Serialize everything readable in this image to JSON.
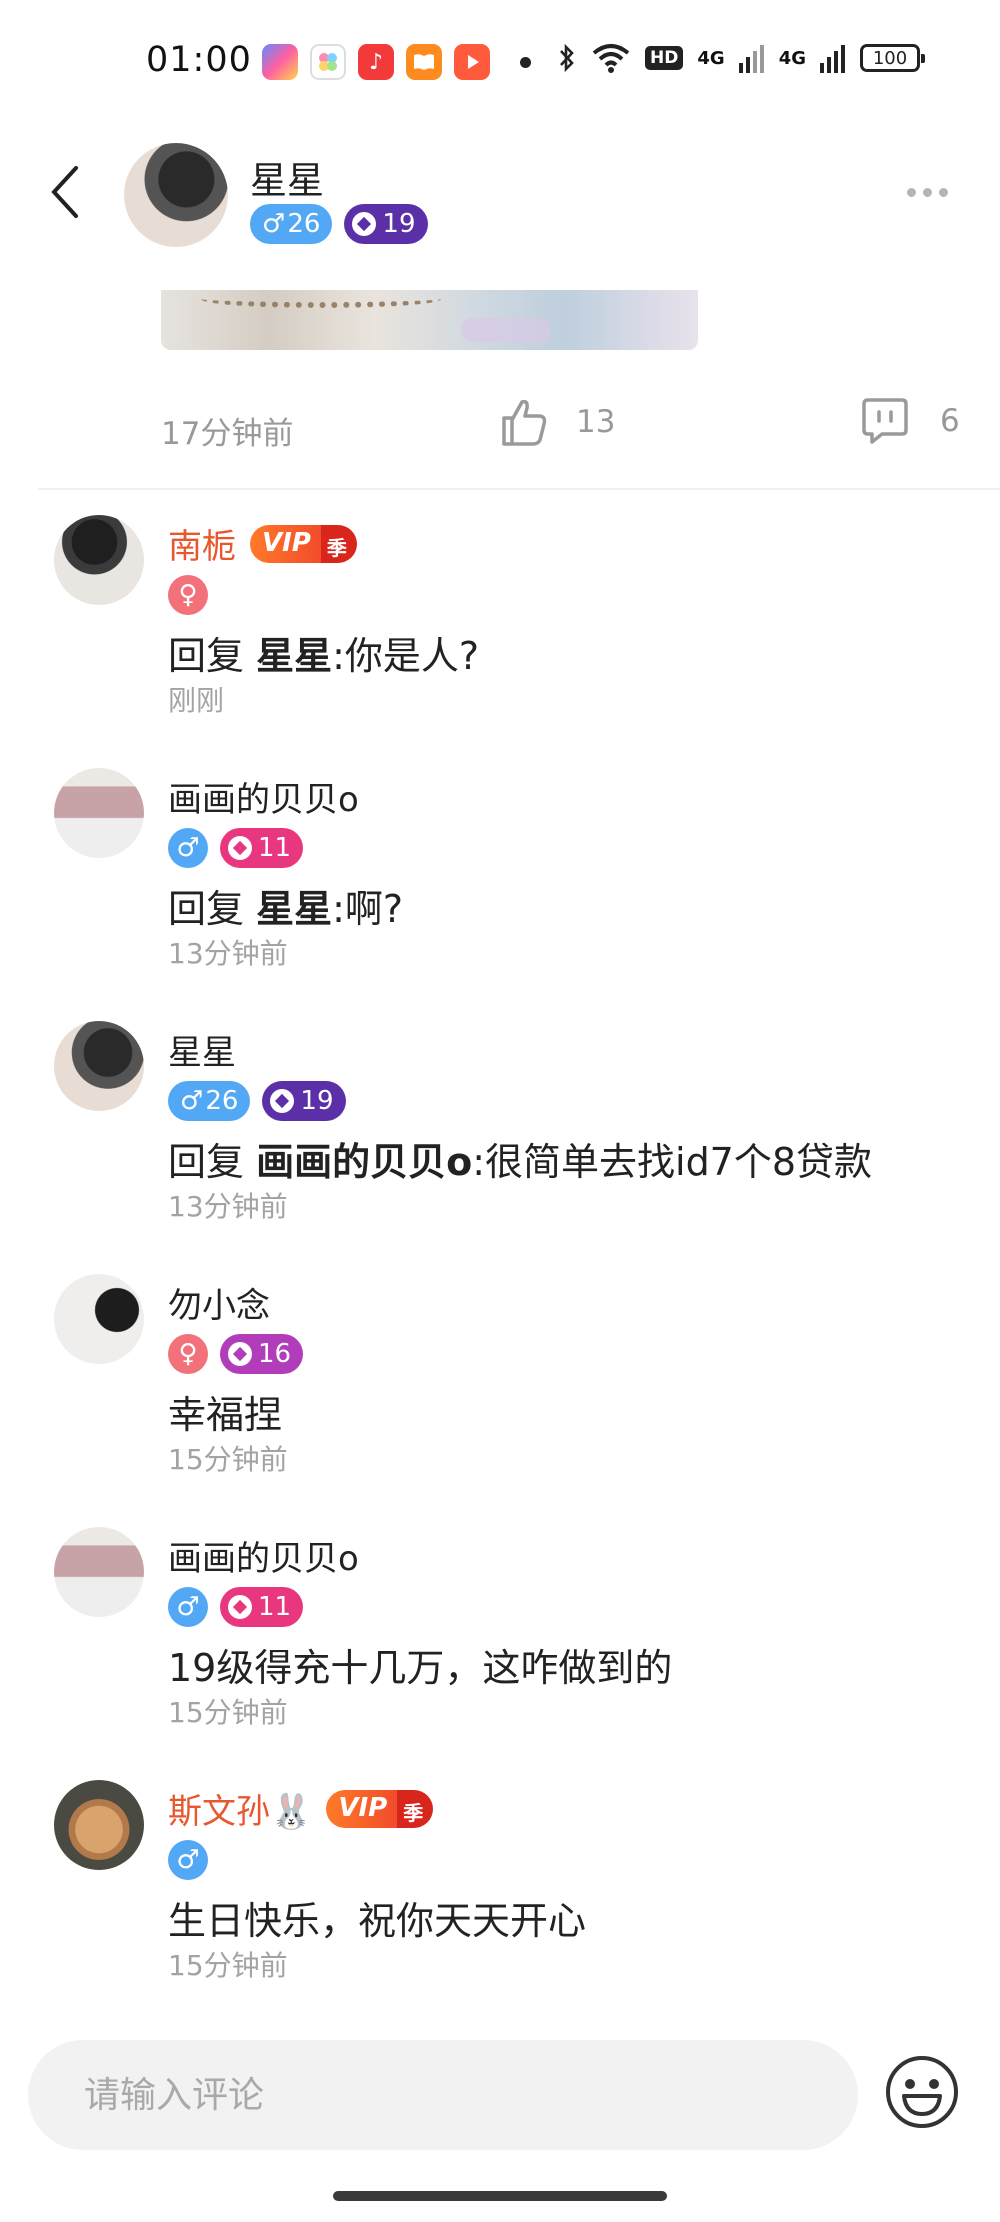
{
  "status_bar": {
    "time": "01:00",
    "network_1": "4G",
    "network_2": "4G",
    "hd_label": "HD",
    "battery": "100"
  },
  "header": {
    "user_name": "星星",
    "gender_age": "26",
    "level": "19"
  },
  "post": {
    "time": "17分钟前",
    "likes": "13",
    "comments": "6"
  },
  "comments": [
    {
      "user": "南栀",
      "vip": true,
      "vip_label": "VIP",
      "vip_tag": "季",
      "gender": "female",
      "gender_label": "",
      "level": "",
      "reply_prefix": "回复 ",
      "reply_to": "星星",
      "text": ":你是人?",
      "time": "刚刚"
    },
    {
      "user": "画画的贝贝o",
      "vip": false,
      "gender": "male",
      "gender_label": "",
      "level": "11",
      "reply_prefix": "回复 ",
      "reply_to": "星星",
      "text": ":啊?",
      "time": "13分钟前"
    },
    {
      "user": "星星",
      "vip": false,
      "gender": "male",
      "gender_label": "26",
      "level": "19",
      "reply_prefix": "回复 ",
      "reply_to": "画画的贝贝o",
      "text": ":很简单去找id7个8贷款",
      "time": "13分钟前"
    },
    {
      "user": "勿小念",
      "vip": false,
      "gender": "female",
      "gender_label": "",
      "level": "16",
      "reply_prefix": "",
      "reply_to": "",
      "text": "幸福捏",
      "time": "15分钟前"
    },
    {
      "user": "画画的贝贝o",
      "vip": false,
      "gender": "male",
      "gender_label": "",
      "level": "11",
      "reply_prefix": "",
      "reply_to": "",
      "text": "19级得充十几万，这咋做到的",
      "time": "15分钟前"
    },
    {
      "user": "斯文孙🐰",
      "vip": true,
      "vip_label": "VIP",
      "vip_tag": "季",
      "gender": "male",
      "gender_label": "",
      "level": "",
      "reply_prefix": "",
      "reply_to": "",
      "text": "生日快乐，祝你天天开心",
      "time": "15分钟前"
    }
  ],
  "input": {
    "placeholder": "请输入评论"
  },
  "colors": {
    "vip_name": "#e8582f",
    "male_badge": "#52a8f4",
    "female_badge": "#f2717a",
    "level_19": "#5b2fa8",
    "level_11": "#e8377e",
    "level_16": "#b23dbb"
  }
}
